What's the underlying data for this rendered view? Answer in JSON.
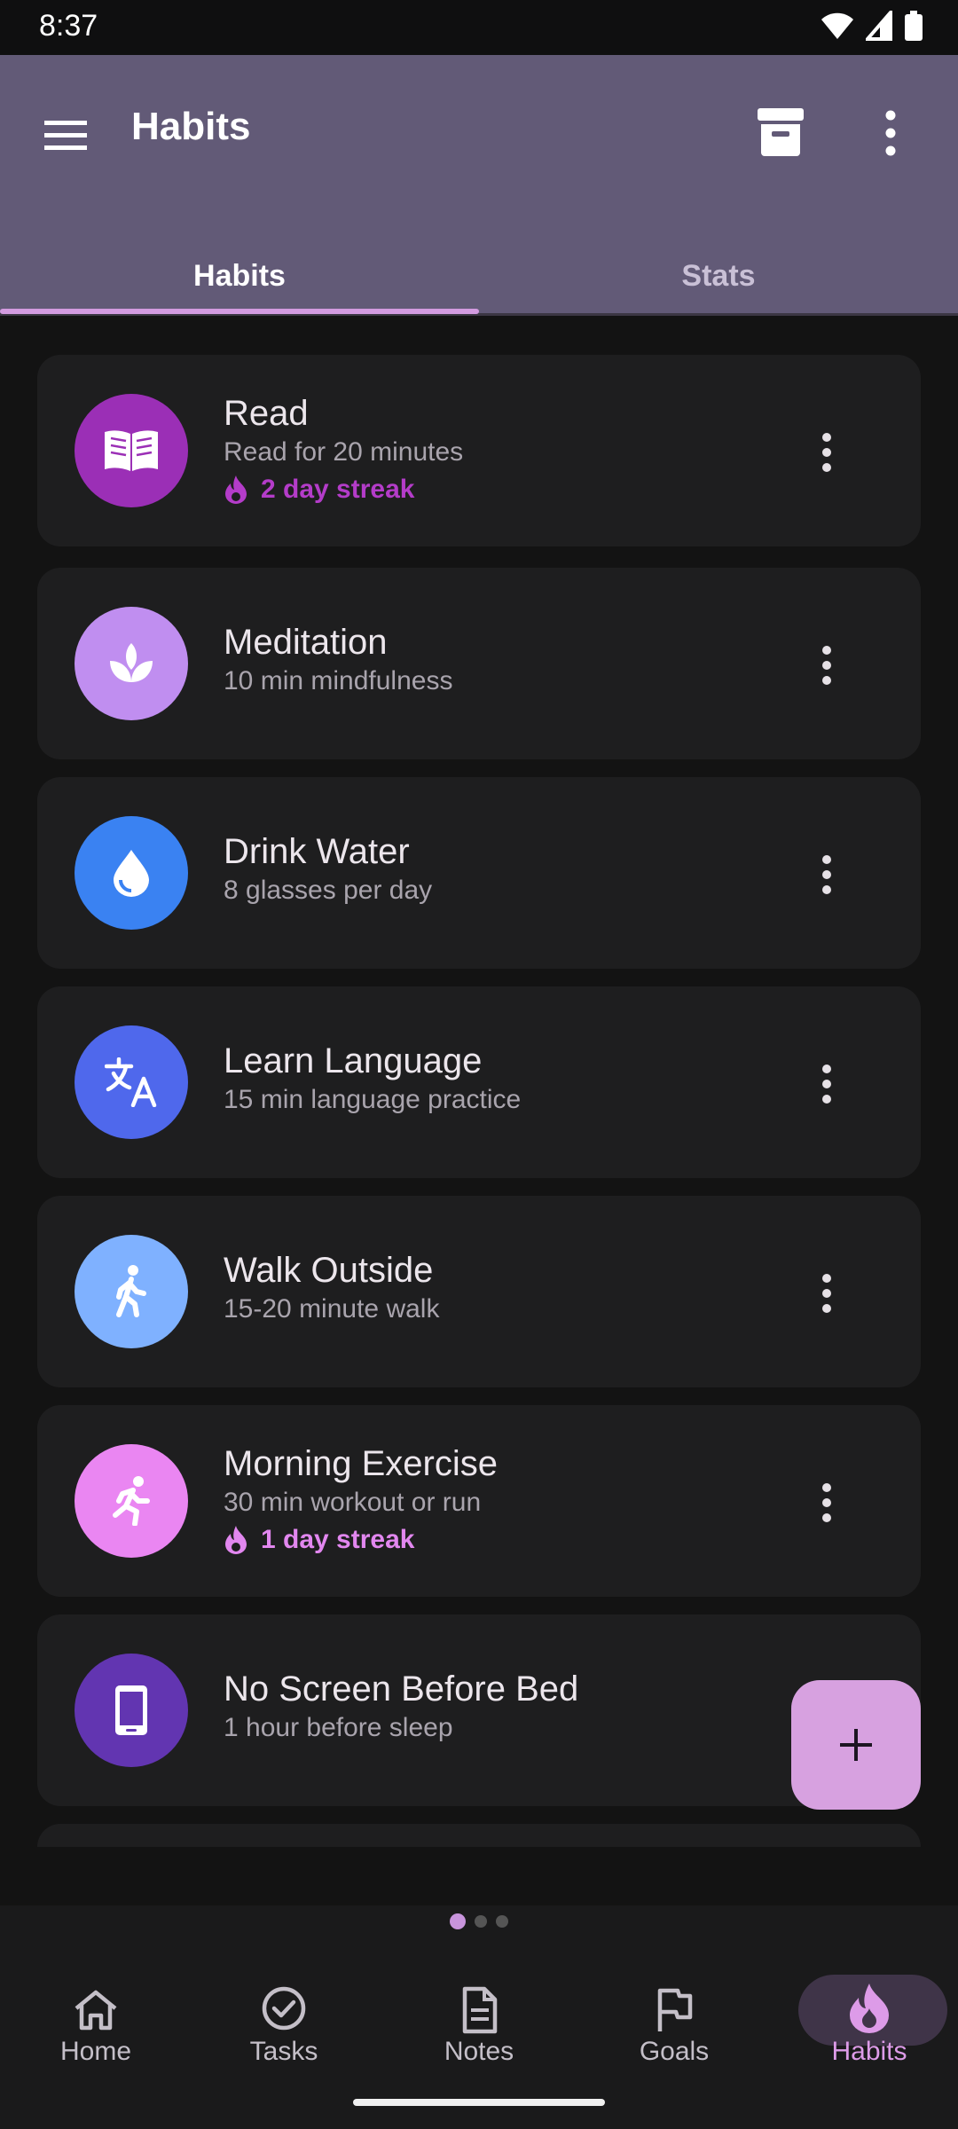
{
  "status": {
    "time": "8:37"
  },
  "appbar": {
    "title": "Habits"
  },
  "tabs": [
    {
      "label": "Habits"
    },
    {
      "label": "Stats"
    }
  ],
  "habits": [
    {
      "name": "Read",
      "desc": "Read for 20 minutes",
      "streak": "2 day streak",
      "color": "#9b2fb6",
      "streak_color": "#b43cc9",
      "icon": "book-icon"
    },
    {
      "name": "Meditation",
      "desc": "10 min mindfulness",
      "streak": "",
      "color": "#c08ef0",
      "icon": "lotus-icon"
    },
    {
      "name": "Drink Water",
      "desc": "8 glasses per day",
      "streak": "",
      "color": "#3a82f2",
      "icon": "water-drop-icon"
    },
    {
      "name": "Learn Language",
      "desc": "15 min language practice",
      "streak": "",
      "color": "#4f68ec",
      "icon": "translate-icon"
    },
    {
      "name": "Walk Outside",
      "desc": "15-20 minute walk",
      "streak": "",
      "color": "#7fb1ff",
      "icon": "walk-icon"
    },
    {
      "name": "Morning Exercise",
      "desc": "30 min workout or run",
      "streak": "1 day streak",
      "color": "#ea86f2",
      "streak_color": "#e287ef",
      "icon": "run-icon"
    },
    {
      "name": "No Screen Before Bed",
      "desc": "1 hour before sleep",
      "streak": "",
      "color": "#6235b1",
      "icon": "phone-icon"
    }
  ],
  "bottom_nav": [
    {
      "label": "Home",
      "icon": "home-icon"
    },
    {
      "label": "Tasks",
      "icon": "check-circle-icon"
    },
    {
      "label": "Notes",
      "icon": "document-icon"
    },
    {
      "label": "Goals",
      "icon": "flag-icon"
    },
    {
      "label": "Habits",
      "icon": "flame-icon"
    }
  ]
}
